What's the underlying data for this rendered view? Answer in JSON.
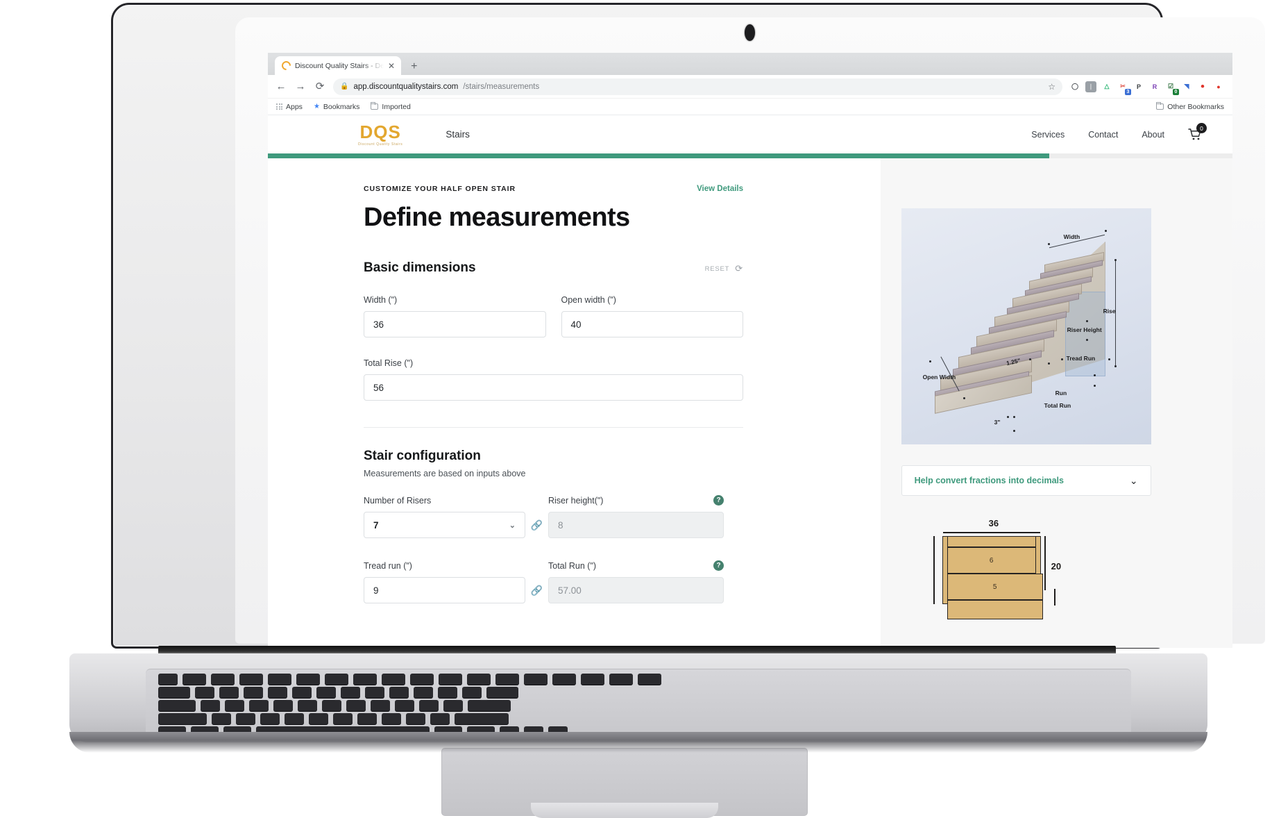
{
  "browser": {
    "tab": {
      "title": "Discount Quality Stairs - Define ",
      "close_label": "✕",
      "favicon": "dqs-favicon"
    },
    "new_tab_label": "+",
    "nav": {
      "back": "←",
      "forward": "→",
      "reload": "⟳"
    },
    "url": {
      "lock": "🔒",
      "host": "app.discountqualitystairs.com",
      "path": "/stairs/measurements"
    },
    "star_label": "☆",
    "extensions": [
      {
        "name": "circle-extension",
        "glyph": "◯",
        "bg": "#ffffff",
        "fg": "#4d5156"
      },
      {
        "name": "grammar-extension",
        "glyph": "ᛁ",
        "bg": "#9aa0a6",
        "fg": "#ffffff"
      },
      {
        "name": "triangle-extension",
        "glyph": "△",
        "bg": "#ffffff",
        "fg": "#2bb673"
      },
      {
        "name": "scissors-extension",
        "glyph": "✂",
        "bg": "#ffffff",
        "fg": "#e05a4f",
        "badge": "3",
        "badge_color": "blue"
      },
      {
        "name": "pinterest-extension",
        "glyph": "P",
        "bg": "#ffffff",
        "fg": "#3c4043"
      },
      {
        "name": "rakuten-extension",
        "glyph": "R",
        "bg": "#ffffff",
        "fg": "#7b3fb5"
      },
      {
        "name": "tasks-extension",
        "glyph": "☑",
        "bg": "#ffffff",
        "fg": "#2f6f3e",
        "badge": "0",
        "badge_color": "green"
      },
      {
        "name": "cast-extension",
        "glyph": "◥",
        "bg": "#ffffff",
        "fg": "#3b6fd4"
      },
      {
        "name": "record-extension",
        "glyph": "⏺",
        "bg": "#ffffff",
        "fg": "#e0352b"
      },
      {
        "name": "profile-extension",
        "glyph": "●",
        "bg": "#ffffff",
        "fg": "#e0352b"
      }
    ],
    "bookmarks": {
      "apps": "Apps",
      "bookmarks": "Bookmarks",
      "imported": "Imported",
      "other": "Other Bookmarks"
    }
  },
  "site": {
    "logo": {
      "mark": "DQS",
      "subtitle": "Discount Quality Stairs"
    },
    "nav_primary": "Stairs",
    "nav_right": [
      "Services",
      "Contact",
      "About"
    ],
    "cart_count": "0",
    "progress_percent": 81
  },
  "main": {
    "eyebrow": "CUSTOMIZE YOUR HALF OPEN STAIR",
    "view_details": "View Details",
    "title": "Define measurements",
    "basic": {
      "heading": "Basic dimensions",
      "reset_label": "RESET",
      "fields": [
        {
          "label": "Width (\")",
          "value": "36"
        },
        {
          "label": "Open width (\")",
          "value": "40"
        },
        {
          "label": "Total Rise (\")",
          "value": "56"
        }
      ]
    },
    "config": {
      "heading": "Stair configuration",
      "note": "Measurements are based on inputs above",
      "rows": [
        {
          "left_label": "Number of Risers",
          "left_value": "7",
          "left_type": "select",
          "right_label": "Riser height(\")",
          "right_value": "8",
          "right_disabled": true
        },
        {
          "left_label": "Tread run (\")",
          "left_value": "9",
          "left_type": "input",
          "right_label": "Total Run (\")",
          "right_value": "57.00",
          "right_disabled": true
        }
      ]
    }
  },
  "preview": {
    "photo_labels": {
      "width": "Width",
      "rise": "Rise",
      "riser_height": "Riser Height",
      "tread_run": "Tread Run",
      "open_width": "Open Width",
      "run": "Run",
      "total_run": "Total Run",
      "nosing": "1.25\"",
      "overhang": "3\""
    },
    "accordion_label": "Help convert fractions into decimals",
    "plan": {
      "width_dim": "36",
      "depth_dim": "20",
      "step_labels": [
        "6",
        "5"
      ]
    }
  },
  "colors": {
    "brand_green": "#3f9a7d",
    "logo_gold": "#e3a72f",
    "help_icon": "#45816e",
    "wood": "#dcb878"
  }
}
